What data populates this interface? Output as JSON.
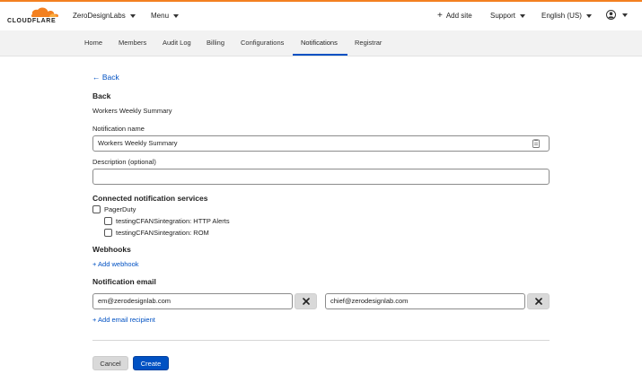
{
  "brand": {
    "logo_text": "CLOUDFLARE",
    "accent": "#f38020",
    "link": "#0051c3"
  },
  "topbar": {
    "account": "ZeroDesignLabs",
    "menu": "Menu",
    "add_site": "Add site",
    "support": "Support",
    "language": "English (US)"
  },
  "nav": {
    "tabs": [
      {
        "label": "Home"
      },
      {
        "label": "Members"
      },
      {
        "label": "Audit Log"
      },
      {
        "label": "Billing"
      },
      {
        "label": "Configurations"
      },
      {
        "label": "Notifications",
        "active": true
      },
      {
        "label": "Registrar"
      }
    ]
  },
  "page": {
    "back_link": "← Back",
    "heading": "Back",
    "subheading": "Workers Weekly Summary",
    "name_label": "Notification name",
    "name_value": "Workers Weekly Summary",
    "description_label": "Description (optional)",
    "description_value": "",
    "services_heading": "Connected notification services",
    "services": [
      {
        "label": "PagerDuty",
        "checked": false
      },
      {
        "label": "testingCFANSintegration: HTTP Alerts",
        "checked": false
      },
      {
        "label": "testingCFANSintegration: ROM",
        "checked": false
      }
    ],
    "webhooks_heading": "Webhooks",
    "add_webhook": "+ Add webhook",
    "email_heading": "Notification email",
    "emails": [
      "em@zerodesignlab.com",
      "chief@zerodesignlab.com"
    ],
    "add_email": "+ Add email recipient",
    "cancel": "Cancel",
    "create": "Create"
  }
}
